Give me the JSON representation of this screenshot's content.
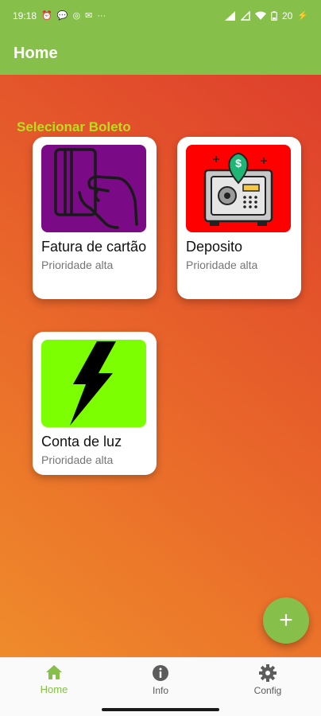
{
  "status_bar": {
    "time": "19:18",
    "left_icons": [
      "alarm-icon",
      "chat-icon",
      "instagram-icon",
      "mail-icon",
      "more-icon"
    ],
    "battery": "20"
  },
  "app_bar": {
    "title": "Home"
  },
  "section_title": "Selecionar Boleto",
  "cards": [
    {
      "title": "Fatura de cartão",
      "subtitle": "Prioridade alta",
      "icon": "credit-card-hand-icon",
      "bg": "#7a0a86"
    },
    {
      "title": "Deposito",
      "subtitle": "Prioridade alta",
      "icon": "safe-money-icon",
      "bg": "#ff0000"
    },
    {
      "title": "Conta de luz",
      "subtitle": "Prioridade alta",
      "icon": "lightning-icon",
      "bg": "#7cff00"
    }
  ],
  "fab": {
    "label": "+"
  },
  "bottom_nav": [
    {
      "label": "Home",
      "icon": "home-icon",
      "active": true
    },
    {
      "label": "Info",
      "icon": "info-icon",
      "active": false
    },
    {
      "label": "Config",
      "icon": "gear-icon",
      "active": false
    }
  ],
  "colors": {
    "primary": "#86c04a",
    "section_title": "#b6e01b"
  }
}
